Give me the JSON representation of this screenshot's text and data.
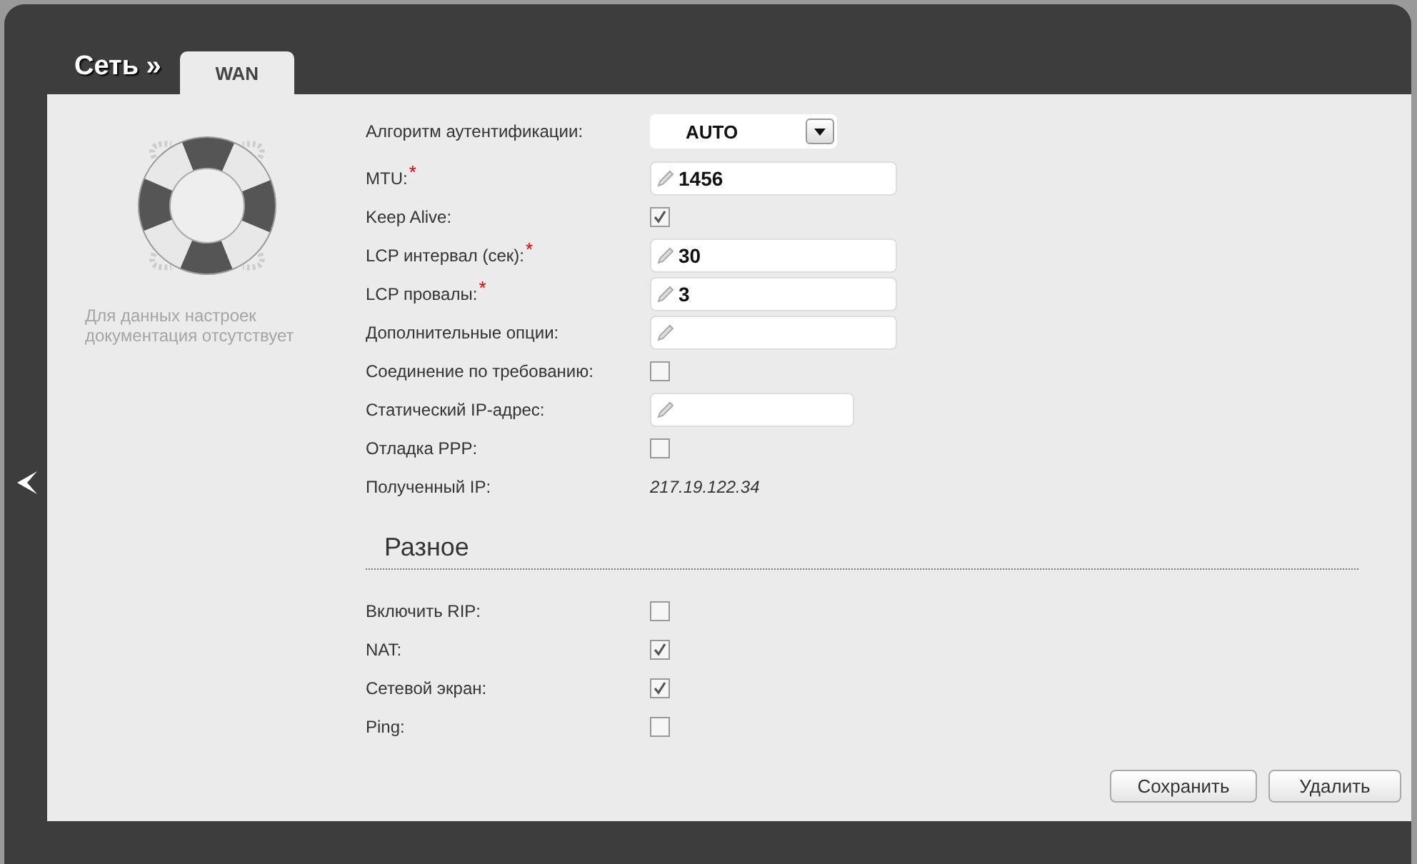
{
  "header": {
    "section": "Сеть »",
    "tabs": [
      {
        "label": "WAN",
        "selected": true
      }
    ]
  },
  "sidebar": {
    "help_text": "Для данных настроек документация отсутствует"
  },
  "form": {
    "rows": [
      {
        "kind": "select",
        "label": "Алгоритм аутентификации:",
        "value": "AUTO"
      },
      {
        "kind": "text",
        "label": "MTU:$^{*}$",
        "value": "1456"
      },
      {
        "kind": "checkbox",
        "label": "Keep Alive:",
        "checked": true
      },
      {
        "kind": "text",
        "label": "LCP интервал (сек):$^{*}$",
        "value": "30"
      },
      {
        "kind": "text",
        "label": "LCP провалы:$^{*}$",
        "value": "3"
      },
      {
        "kind": "text",
        "label": "Дополнительные опции:"
      },
      {
        "kind": "checkbox",
        "label": "Соединение по требованию:",
        "checked": false
      },
      {
        "kind": "text",
        "label": "Статический IP-адрес:"
      },
      {
        "kind": "checkbox",
        "label": "Отладка PPP:",
        "checked": false
      },
      {
        "kind": "static",
        "label": "Полученный IP:",
        "value": "217.19.122.34"
      }
    ]
  },
  "misc": {
    "title": "Разное",
    "rows": [
      {
        "kind": "checkbox",
        "label": "Включить RIP:",
        "checked": false
      },
      {
        "kind": "checkbox",
        "label": "NAT:",
        "checked": true
      },
      {
        "kind": "checkbox",
        "label": "Сетевой экран:",
        "checked": true
      },
      {
        "kind": "checkbox",
        "label": "Ping:",
        "checked": false
      }
    ]
  },
  "buttons": [
    "Сохранить",
    "Удалить"
  ]
}
